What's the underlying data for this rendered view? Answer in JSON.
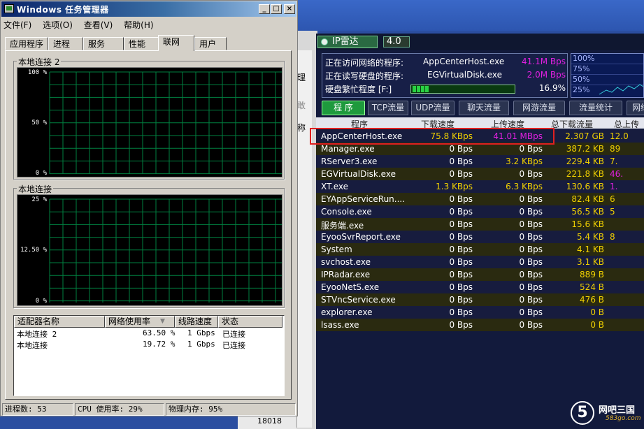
{
  "task_manager": {
    "title": "Windows 任务管理器",
    "window_buttons": [
      "_",
      "□",
      "×"
    ],
    "menu": [
      "文件(F)",
      "选项(O)",
      "查看(V)",
      "帮助(H)"
    ],
    "tabs": [
      "应用程序",
      "进程",
      "服务",
      "性能",
      "联网",
      "用户"
    ],
    "active_tab": "联网",
    "graph1": {
      "label": "本地连接 2",
      "y_labels": [
        "100 %",
        "50 %",
        "0 %"
      ]
    },
    "graph2": {
      "label": "本地连接",
      "y_labels": [
        "25 %",
        "12.50 %",
        "0 %"
      ]
    },
    "adapter_table": {
      "headers": [
        "适配器名称",
        "网络使用率",
        "线路速度",
        "状态"
      ],
      "rows": [
        {
          "name": "本地连接 2",
          "usage": "63.50 %",
          "speed": "1 Gbps",
          "status": "已连接"
        },
        {
          "name": "本地连接",
          "usage": "19.72 %",
          "speed": "1 Gbps",
          "status": "已连接"
        }
      ]
    },
    "status_bar": {
      "processes": "进程数: 53",
      "cpu": "CPU 使用率: 29%",
      "memory": "物理内存: 95%"
    }
  },
  "background": {
    "labels": [
      "理",
      "敢",
      "称"
    ],
    "bottom_text": "18018"
  },
  "ip_radar": {
    "app_name": "IP雷达",
    "version": "4.0",
    "info": [
      {
        "label": "正在访问网络的程序:",
        "program": "AppCenterHost.exe",
        "value": "41.1M Bps"
      },
      {
        "label": "正在读写硬盘的程序:",
        "program": "EGVirtualDisk.exe",
        "value": "2.0M Bps"
      }
    ],
    "disk_busy_label": "硬盘繁忙程度 [F:]",
    "disk_busy_value": "16.9%",
    "disk_busy_fraction": 0.169,
    "graph_labels": [
      "100%",
      "75%",
      "50%",
      "25%"
    ],
    "tabs": [
      "程 序",
      "TCP流量",
      "UDP流量",
      "聊天流量",
      "网游流量",
      "流量统计",
      "网络"
    ],
    "columns": [
      "程序",
      "下载速度",
      "上传速度",
      "总下载流量",
      "总上传流"
    ],
    "rows": [
      {
        "name": "AppCenterHost.exe",
        "dl": "75.8 KBps",
        "ul": "41.01 MBps",
        "td": "2.307 GB",
        "tu": "12.0"
      },
      {
        "name": "Manager.exe",
        "dl": "0 Bps",
        "ul": "0 Bps",
        "td": "387.2 KB",
        "tu": "89"
      },
      {
        "name": "RServer3.exe",
        "dl": "0 Bps",
        "ul": "3.2 KBps",
        "td": "229.4 KB",
        "tu": "7."
      },
      {
        "name": "EGVirtualDisk.exe",
        "dl": "0 Bps",
        "ul": "0 Bps",
        "td": "221.8 KB",
        "tu": "46."
      },
      {
        "name": "XT.exe",
        "dl": "1.3 KBps",
        "ul": "6.3 KBps",
        "td": "130.6 KB",
        "tu": "1."
      },
      {
        "name": "EYAppServiceRun....",
        "dl": "0 Bps",
        "ul": "0 Bps",
        "td": "82.4 KB",
        "tu": "6"
      },
      {
        "name": "Console.exe",
        "dl": "0 Bps",
        "ul": "0 Bps",
        "td": "56.5 KB",
        "tu": "5"
      },
      {
        "name": "服务端.exe",
        "dl": "0 Bps",
        "ul": "0 Bps",
        "td": "15.6 KB",
        "tu": ""
      },
      {
        "name": "EyooSvrReport.exe",
        "dl": "0 Bps",
        "ul": "0 Bps",
        "td": "5.4 KB",
        "tu": "8"
      },
      {
        "name": "System",
        "dl": "0 Bps",
        "ul": "0 Bps",
        "td": "4.1 KB",
        "tu": ""
      },
      {
        "name": "svchost.exe",
        "dl": "0 Bps",
        "ul": "0 Bps",
        "td": "3.1 KB",
        "tu": ""
      },
      {
        "name": "IPRadar.exe",
        "dl": "0 Bps",
        "ul": "0 Bps",
        "td": "889 B",
        "tu": ""
      },
      {
        "name": "EyooNetS.exe",
        "dl": "0 Bps",
        "ul": "0 Bps",
        "td": "524 B",
        "tu": ""
      },
      {
        "name": "STVncService.exe",
        "dl": "0 Bps",
        "ul": "0 Bps",
        "td": "476 B",
        "tu": ""
      },
      {
        "name": "explorer.exe",
        "dl": "0 Bps",
        "ul": "0 Bps",
        "td": "0 B",
        "tu": ""
      },
      {
        "name": "lsass.exe",
        "dl": "0 Bps",
        "ul": "0 Bps",
        "td": "0 B",
        "tu": ""
      }
    ]
  },
  "watermark": {
    "glyph": "5",
    "brand": "网吧三国",
    "url": "583go.com"
  },
  "colors": {
    "grid_green": "#008040",
    "radar_yellow": "#f0d000",
    "radar_magenta": "#e020e0",
    "highlight": "#e02020"
  }
}
